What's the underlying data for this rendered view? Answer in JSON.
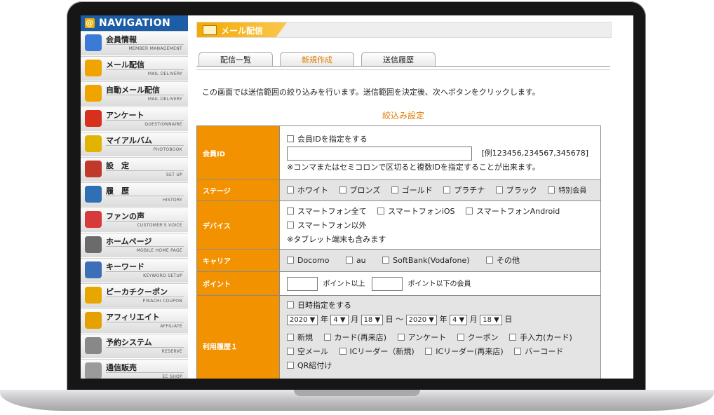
{
  "sidebar": {
    "header": "NAVIGATION",
    "items": [
      {
        "jp": "会員情報",
        "en": "MEMBER MANAGEMENT",
        "icon": "members-icon",
        "color": "#3a7bd5"
      },
      {
        "jp": "メール配信",
        "en": "MAIL DELIVERY",
        "icon": "envelope-icon",
        "color": "#f0a400"
      },
      {
        "jp": "自動メール配信",
        "en": "MAIL DELIVERY",
        "icon": "auto-mail-icon",
        "color": "#f0a400"
      },
      {
        "jp": "アンケート",
        "en": "QUESTIONNAIRE",
        "icon": "pie-chart-icon",
        "color": "#d8301e"
      },
      {
        "jp": "マイアルバム",
        "en": "PHOTOBOOK",
        "icon": "album-icon",
        "color": "#e2b400"
      },
      {
        "jp": "設　定",
        "en": "SET UP",
        "icon": "tools-icon",
        "color": "#c0392b"
      },
      {
        "jp": "履　歴",
        "en": "HISTORY",
        "icon": "history-icon",
        "color": "#2f6fb3"
      },
      {
        "jp": "ファンの声",
        "en": "CUSTOMER'S VOICE",
        "icon": "heart-icon",
        "color": "#d63a3a"
      },
      {
        "jp": "ホームページ",
        "en": "MOBILE HOME PAGE",
        "icon": "mobile-icon",
        "color": "#6b6b6b"
      },
      {
        "jp": "キーワード",
        "en": "KEYWORD SETUP",
        "icon": "pen-icon",
        "color": "#3c6fb8"
      },
      {
        "jp": "ピーカチクーポン",
        "en": "P!KACHI COUPON",
        "icon": "gift-icon",
        "color": "#e8a600"
      },
      {
        "jp": "アフィリエイト",
        "en": "AFFILIATE",
        "icon": "coin-icon",
        "color": "#e5a100"
      },
      {
        "jp": "予約システム",
        "en": "RESERVE",
        "icon": "clock-icon",
        "color": "#888888"
      },
      {
        "jp": "通信販売",
        "en": "EC SHOP",
        "icon": "cart-icon",
        "color": "#9a9a9a"
      }
    ]
  },
  "page": {
    "title": "メール配信",
    "tabs": [
      {
        "label": "配信一覧",
        "active": false
      },
      {
        "label": "新規作成",
        "active": true
      },
      {
        "label": "送信履歴",
        "active": false
      }
    ],
    "description": "この画面では送信範囲の絞り込みを行います。送信範囲を決定後、次へボタンをクリックします。",
    "section_title": "絞込み設定"
  },
  "form": {
    "member_id": {
      "label": "会員ID",
      "checkbox": "会員IDを指定をする",
      "example": "[例123456,234567,345678]",
      "note": "※コンマまたはセミコロンで区切ると複数IDを指定することが出来ます。"
    },
    "stage": {
      "label": "ステージ",
      "options": [
        "ホワイト",
        "ブロンズ",
        "ゴールド",
        "プラチナ",
        "ブラック",
        "特別会員"
      ]
    },
    "device": {
      "label": "デバイス",
      "options": [
        "スマートフォン全て",
        "スマートフォンiOS",
        "スマートフォンAndroid",
        "スマートフォン以外"
      ],
      "note": "※タブレット端末も含みます"
    },
    "carrier": {
      "label": "キャリア",
      "options": [
        "Docomo",
        "au",
        "SoftBank(Vodafone)",
        "その他"
      ]
    },
    "point": {
      "label": "ポイント",
      "min_suffix": "ポイント以上",
      "max_suffix": "ポイント以下の会員"
    },
    "usage": {
      "label": "利用履歴１",
      "checkbox": "日時指定をする",
      "year_label": "年",
      "month_label": "月",
      "day_label": "日",
      "range_sep": "日 ～",
      "from": {
        "year": "2020 ▼",
        "month": "4 ▼",
        "day": "18 ▼"
      },
      "to": {
        "year": "2020 ▼",
        "month": "4 ▼",
        "day": "18 ▼"
      },
      "options": [
        "新規",
        "カード(再来店)",
        "アンケート",
        "クーポン",
        "手入力(カード)",
        "空メール",
        "ICリーダー（新規)",
        "ICリーダー(再来店)",
        "バーコード",
        "QR紹付け"
      ]
    }
  }
}
